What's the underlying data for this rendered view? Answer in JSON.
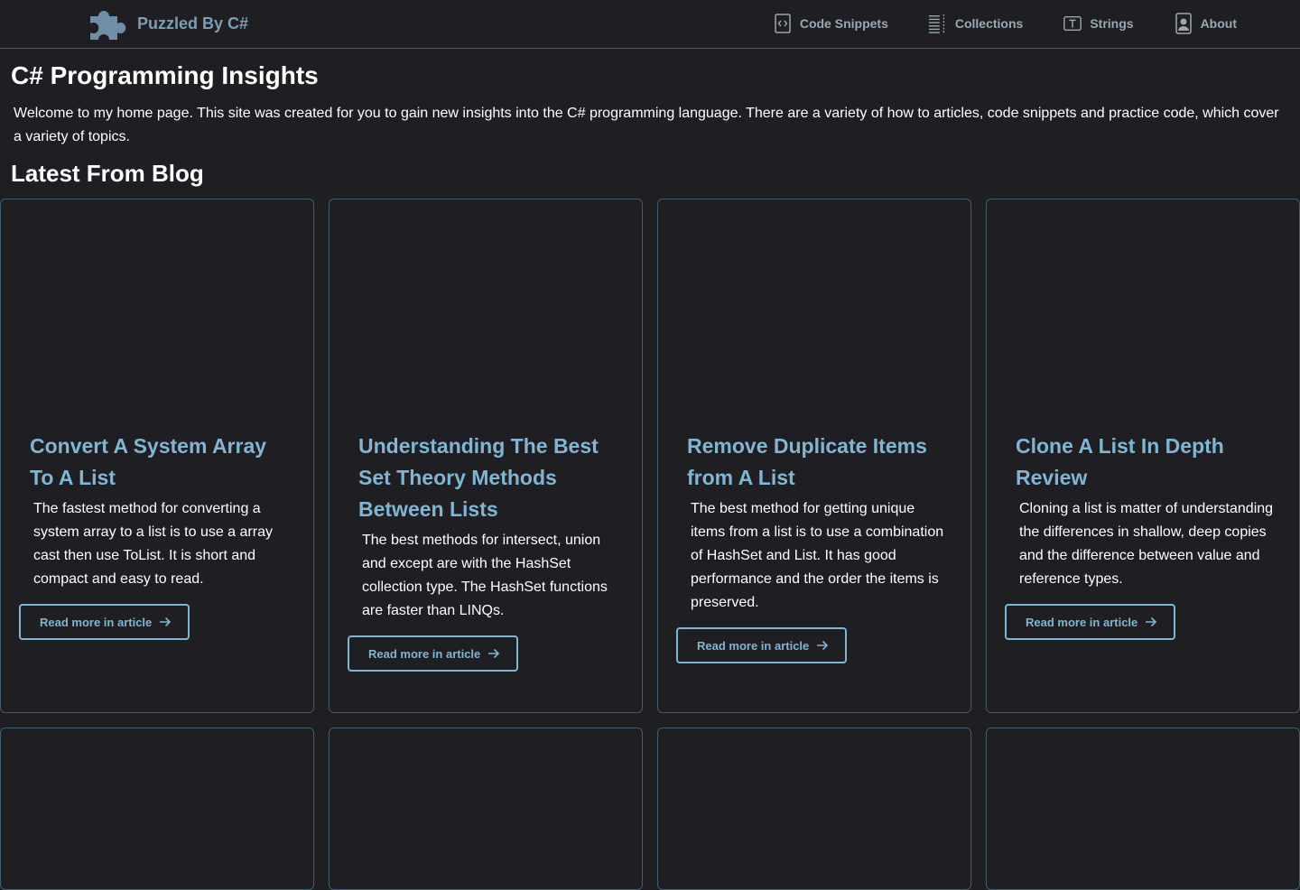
{
  "header": {
    "brand_name": "Puzzled By C#",
    "nav": [
      {
        "label": "Code Snippets",
        "icon": "code-icon"
      },
      {
        "label": "Collections",
        "icon": "list-icon"
      },
      {
        "label": "Strings",
        "icon": "text-icon"
      },
      {
        "label": "About",
        "icon": "contact-icon"
      }
    ]
  },
  "main": {
    "title": "C# Programming Insights",
    "intro": "Welcome to my home page. This site was created for you to gain new insights into the C# programming language. There are a variety of how to articles, code snippets and practice code, which cover a variety of topics.",
    "section_title": "Latest From Blog",
    "read_more_label": "Read more in article",
    "cards": [
      {
        "title": "Convert A System Array To A List",
        "text": "The fastest method for converting a system array to a list is to use a array cast then use ToList. It is short and compact and easy to read."
      },
      {
        "title": "Understanding The Best Set Theory Methods Between Lists",
        "text": "The best methods for intersect, union and except are with the HashSet collection type. The HashSet functions are faster than LINQs."
      },
      {
        "title": "Remove Duplicate Items from A List",
        "text": "The best method for getting unique items from a list is to use a combination of HashSet and List. It has good performance and the order the items is preserved."
      },
      {
        "title": "Clone A List In Depth Review",
        "text": "Cloning a list is matter of understanding the differences in shallow, deep copies and the difference between value and reference types."
      }
    ]
  },
  "colors": {
    "background": "#1f1e23",
    "border": "#3d5f6d",
    "accent": "#7fb6d3",
    "nav_text": "#9aa8b3"
  }
}
